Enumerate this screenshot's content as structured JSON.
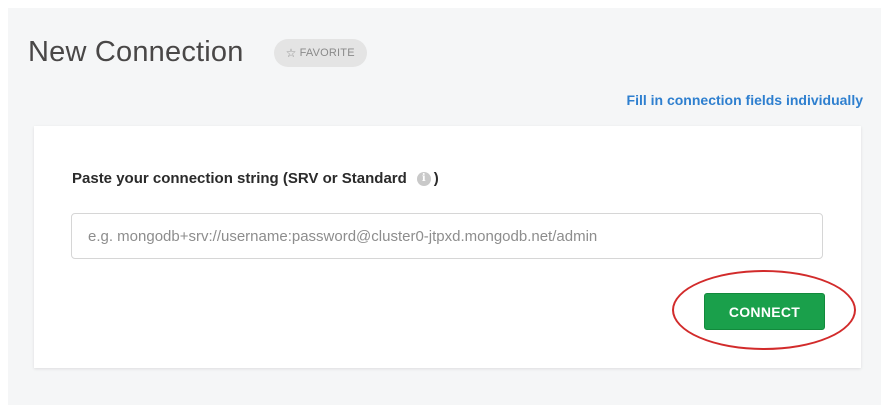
{
  "header": {
    "title": "New Connection",
    "favorite_label": "FAVORITE",
    "favorite_icon": "star-outline-icon"
  },
  "fill_link": {
    "label": "Fill in connection fields individually",
    "color": "#2e7fcf"
  },
  "connection_form": {
    "label": "Paste your connection string (SRV or Standard",
    "label_suffix": ")",
    "info_icon": "info-icon",
    "input": {
      "value": "",
      "placeholder": "e.g. mongodb+srv://username:password@cluster0-jtpxd.mongodb.net/admin"
    },
    "connect_label": "CONNECT",
    "connect_color": "#1aa04b"
  },
  "annotation": {
    "shape": "ellipse",
    "color": "#d22b2b"
  }
}
